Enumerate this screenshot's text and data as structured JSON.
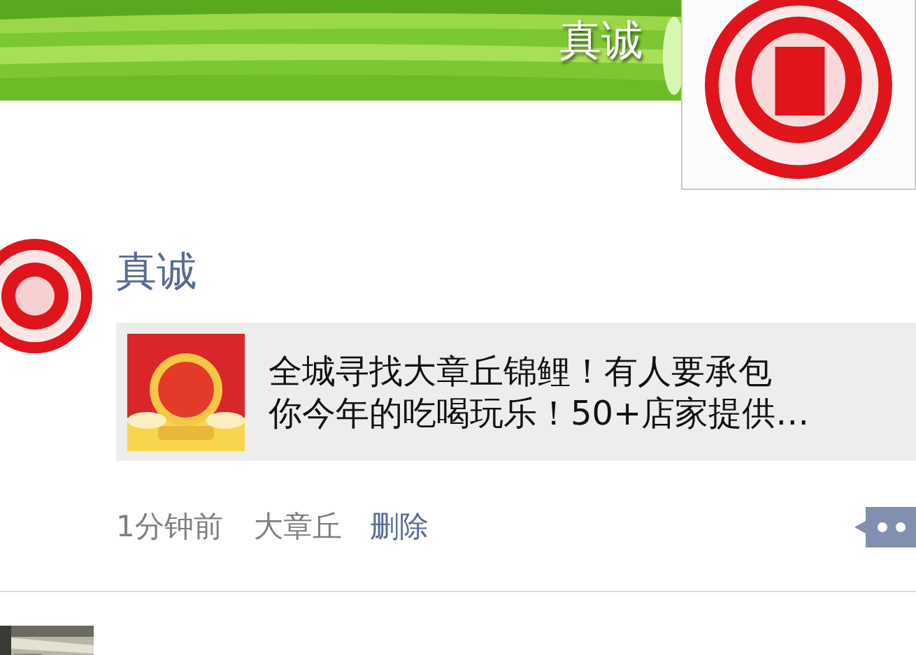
{
  "cover": {
    "name": "真诚"
  },
  "post": {
    "author": "真诚",
    "link": {
      "lines": [
        "全城寻找大章丘锦鲤！有人要承包",
        "你今年的吃喝玩乐！50+店家提供…"
      ]
    },
    "time": "1分钟前",
    "location": "大章丘",
    "delete": "删除"
  }
}
